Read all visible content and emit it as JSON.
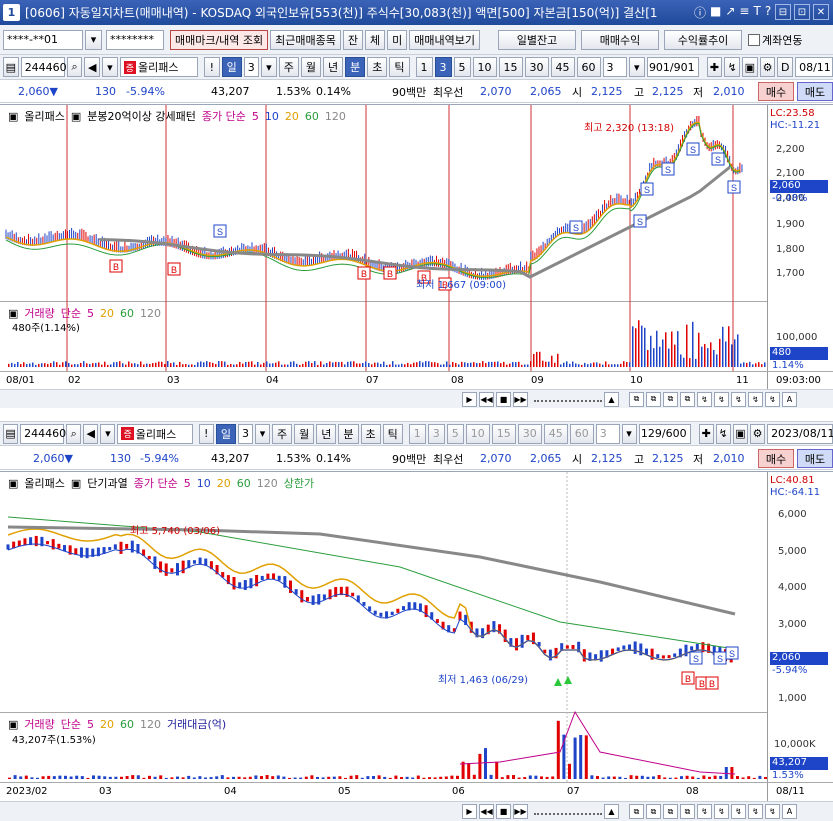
{
  "window": {
    "num": "1",
    "title": "[0606] 자동일지차트(매매내역) - KOSDAQ 외국인보유[553(천)] 주식수[30,083(천)] 액면[500] 자본금[150(억)] 결산[1",
    "icons": [
      "ⓘ",
      "■",
      "↗",
      "≡",
      "T",
      "?"
    ],
    "win_controls": [
      "⊟",
      "⊡",
      "✕"
    ]
  },
  "toolbar1": {
    "account": "****-**01",
    "password": "********",
    "buttons": [
      "매매마크/내역 조회",
      "최근매매종목",
      "잔",
      "체",
      "미",
      "매매내역보기"
    ],
    "right_buttons": [
      "일별잔고",
      "매매수익",
      "수익률추이"
    ],
    "checkbox_label": "계좌연동"
  },
  "top": {
    "controls": {
      "code": "244460",
      "name": "올리패스",
      "period_label": "일",
      "num": "3",
      "period_tabs": [
        "주",
        "월",
        "년",
        "분",
        "초",
        "틱"
      ],
      "intervals": [
        "1",
        "3",
        "5",
        "10",
        "15",
        "30",
        "45",
        "60"
      ],
      "sel_interval": "3",
      "interval_dd": "3",
      "count": "901/901",
      "date": "08/11"
    },
    "quote": {
      "price": "2,060▼",
      "change": "130",
      "pct": "-5.94%",
      "volume": "43,207",
      "vol_pct": "1.53%",
      "rate": "0.14%",
      "label1": "90백만",
      "label2": "최우선",
      "bid1": "2,070",
      "bid2": "2,065",
      "open_l": "시",
      "open": "2,125",
      "high_l": "고",
      "high": "2,125",
      "low_l": "저",
      "low": "2,010",
      "buy": "매수",
      "sell": "매도"
    },
    "legend": {
      "name": "올리패스",
      "pattern": "분봉20억이상 강세패턴",
      "ma_label": "종가 단순",
      "ma": [
        "5",
        "10",
        "20",
        "60",
        "120"
      ]
    },
    "lc": "LC:23.58",
    "hc": "HC:-11.21",
    "yaxis": [
      "2,200",
      "2,100",
      "2,000",
      "1,900",
      "1,800",
      "1,700"
    ],
    "cur_price": "2,060",
    "cur_pct": "-0.48%",
    "high_note": "최고 2,320 (13:18)",
    "low_note": "최저 1,667 (09:00)",
    "vol_legend": {
      "label": "거래량",
      "ma_label": "단순",
      "ma": [
        "5",
        "20",
        "60",
        "120"
      ],
      "value": "480주(1.14%)"
    },
    "vol_yaxis": "100,000",
    "vol_cur": "480",
    "vol_pct": "1.14%",
    "xaxis": [
      "08/01",
      "02",
      "03",
      "04",
      "07",
      "08",
      "09",
      "10",
      "11"
    ],
    "time": "09:03:00"
  },
  "bottom": {
    "controls": {
      "code": "244460",
      "name": "올리패스",
      "period_label": "일",
      "num": "3",
      "period_tabs": [
        "주",
        "월",
        "년",
        "분",
        "초",
        "틱"
      ],
      "intervals": [
        "1",
        "3",
        "5",
        "10",
        "15",
        "30",
        "45",
        "60"
      ],
      "interval_dd": "3",
      "count": "129/600",
      "date": "2023/08/11"
    },
    "quote": {
      "price": "2,060▼",
      "change": "130",
      "pct": "-5.94%",
      "volume": "43,207",
      "vol_pct": "1.53%",
      "rate": "0.14%",
      "label1": "90백만",
      "label2": "최우선",
      "bid1": "2,070",
      "bid2": "2,065",
      "open_l": "시",
      "open": "2,125",
      "high_l": "고",
      "high": "2,125",
      "low_l": "저",
      "low": "2,010",
      "buy": "매수",
      "sell": "매도"
    },
    "legend": {
      "name": "올리패스",
      "short": "단기과열",
      "ma_label": "종가 단순",
      "ma": [
        "5",
        "10",
        "20",
        "60",
        "120"
      ],
      "upper": "상한가"
    },
    "lc": "LC:40.81",
    "hc": "HC:-64.11",
    "yaxis": [
      "6,000",
      "5,000",
      "4,000",
      "3,000",
      "2,000",
      "1,000"
    ],
    "cur_price": "2,060",
    "cur_pct": "-5.94%",
    "high_note": "최고 5,740 (03/06)",
    "low_note": "최저 1,463 (06/29)",
    "vol_legend": {
      "label": "거래량",
      "ma_label": "단순",
      "ma": [
        "5",
        "20",
        "60",
        "120"
      ],
      "amt": "거래대금(억)",
      "value": "43,207주(1.53%)"
    },
    "vol_yaxis": "10,000K",
    "vol_cur": "43,207",
    "vol_pct": "1.53%",
    "xaxis": [
      "2023/02",
      "03",
      "04",
      "05",
      "06",
      "07",
      "08",
      "08/11"
    ]
  },
  "colors": {
    "ma5": "#e0a000",
    "ma10": "#1e44c8",
    "ma20": "#e0a000",
    "ma60": "#2a9d3c",
    "ma120": "#888888",
    "up": "#e00000",
    "down": "#1e44c8",
    "accent": "#3b63b8"
  }
}
